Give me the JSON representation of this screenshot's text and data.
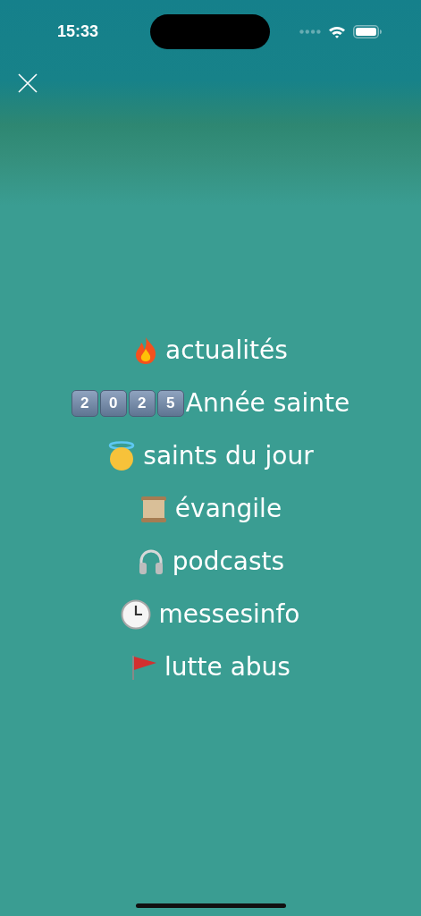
{
  "status_bar": {
    "time": "15:33"
  },
  "menu": [
    {
      "kind": "fire",
      "label": "actualités"
    },
    {
      "kind": "keycaps",
      "keycaps": [
        "2",
        "0",
        "2",
        "5"
      ],
      "label": "Année sainte"
    },
    {
      "kind": "halo",
      "label": "saints du jour"
    },
    {
      "kind": "scroll",
      "label": "évangile"
    },
    {
      "kind": "headphones",
      "label": "podcasts"
    },
    {
      "kind": "clock",
      "label": "messesinfo"
    },
    {
      "kind": "flag",
      "label": "lutte abus"
    }
  ]
}
